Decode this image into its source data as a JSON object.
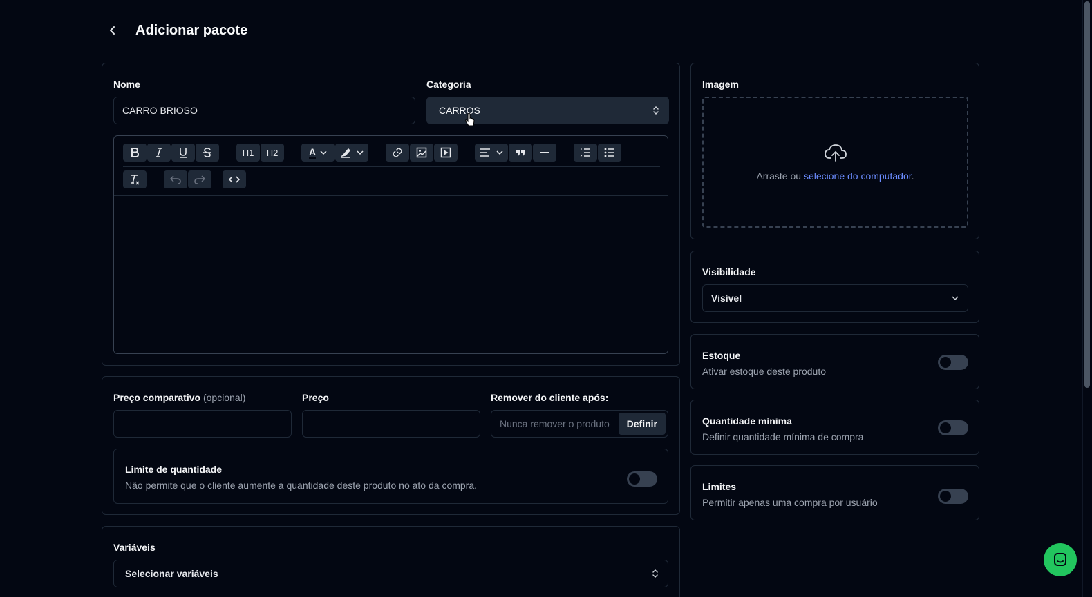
{
  "header": {
    "title": "Adicionar pacote"
  },
  "main_card": {
    "name_label": "Nome",
    "name_value": "CARRO BRIOSO",
    "category_label": "Categoria",
    "category_value": "CARROS",
    "editor": {
      "h1": "H1",
      "h2": "H2",
      "text_color": "A"
    }
  },
  "pricing": {
    "compare_label": "Preço comparativo",
    "compare_optional": "(opcional)",
    "price_label": "Preço",
    "remove_label": "Remover do cliente após:",
    "remove_placeholder": "Nunca remover o produto",
    "define_button": "Definir",
    "limit_title": "Limite de quantidade",
    "limit_desc": "Não permite que o cliente aumente a quantidade deste produto no ato da compra.",
    "limit_enabled": false
  },
  "variables": {
    "label": "Variáveis",
    "select_value": "Selecionar variáveis"
  },
  "image": {
    "label": "Imagem",
    "drop_text": "Arraste ou",
    "drop_link": "selecione do computador",
    "drop_suffix": "."
  },
  "visibility": {
    "label": "Visibilidade",
    "value": "Visível"
  },
  "stock": {
    "title": "Estoque",
    "desc": "Ativar estoque deste produto",
    "enabled": false
  },
  "min_qty": {
    "title": "Quantidade mínima",
    "desc": "Definir quantidade mínima de compra",
    "enabled": false
  },
  "limits": {
    "title": "Limites",
    "desc": "Permitir apenas uma compra por usuário",
    "enabled": false
  },
  "colors": {
    "background": "#030712",
    "border": "#1f2937",
    "link": "#6b8cff",
    "chat_button": "#22c55e"
  }
}
